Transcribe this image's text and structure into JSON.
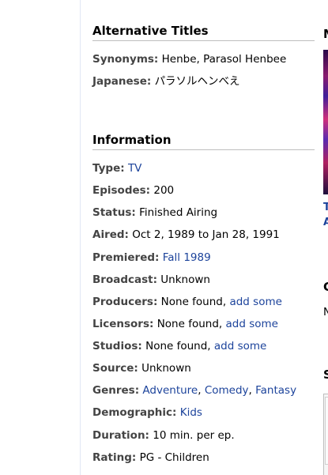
{
  "alternative_titles": {
    "heading": "Alternative Titles",
    "synonyms_label": "Synonyms:",
    "synonyms_value": "Henbe, Parasol Henbee",
    "japanese_label": "Japanese:",
    "japanese_value": "パラソルヘンべえ"
  },
  "information": {
    "heading": "Information",
    "type_label": "Type:",
    "type_value": "TV",
    "episodes_label": "Episodes:",
    "episodes_value": "200",
    "status_label": "Status:",
    "status_value": "Finished Airing",
    "aired_label": "Aired:",
    "aired_value": "Oct 2, 1989 to Jan 28, 1991",
    "premiered_label": "Premiered:",
    "premiered_value": "Fall 1989",
    "broadcast_label": "Broadcast:",
    "broadcast_value": "Unknown",
    "producers_label": "Producers:",
    "producers_value": "None found,",
    "producers_link": "add some",
    "licensors_label": "Licensors:",
    "licensors_value": "None found,",
    "licensors_link": "add some",
    "studios_label": "Studios:",
    "studios_value": "None found,",
    "studios_link": "add some",
    "source_label": "Source:",
    "source_value": "Unknown",
    "genres_label": "Genres:",
    "genres": [
      "Adventure",
      "Comedy",
      "Fantasy"
    ],
    "genre_separator": ",",
    "demographic_label": "Demographic:",
    "demographic_value": "Kids",
    "duration_label": "Duration:",
    "duration_value": "10 min. per ep.",
    "rating_label": "Rating:",
    "rating_value": "PG - Children"
  },
  "right_edge": {
    "letter_1": "M",
    "link_line_1": "T",
    "link_line_2": "A",
    "letter_2": "C",
    "letter_3": "N",
    "letter_4": "S"
  },
  "colors": {
    "link": "#1c439b",
    "label": "#444444",
    "divider": "#bebebe"
  }
}
